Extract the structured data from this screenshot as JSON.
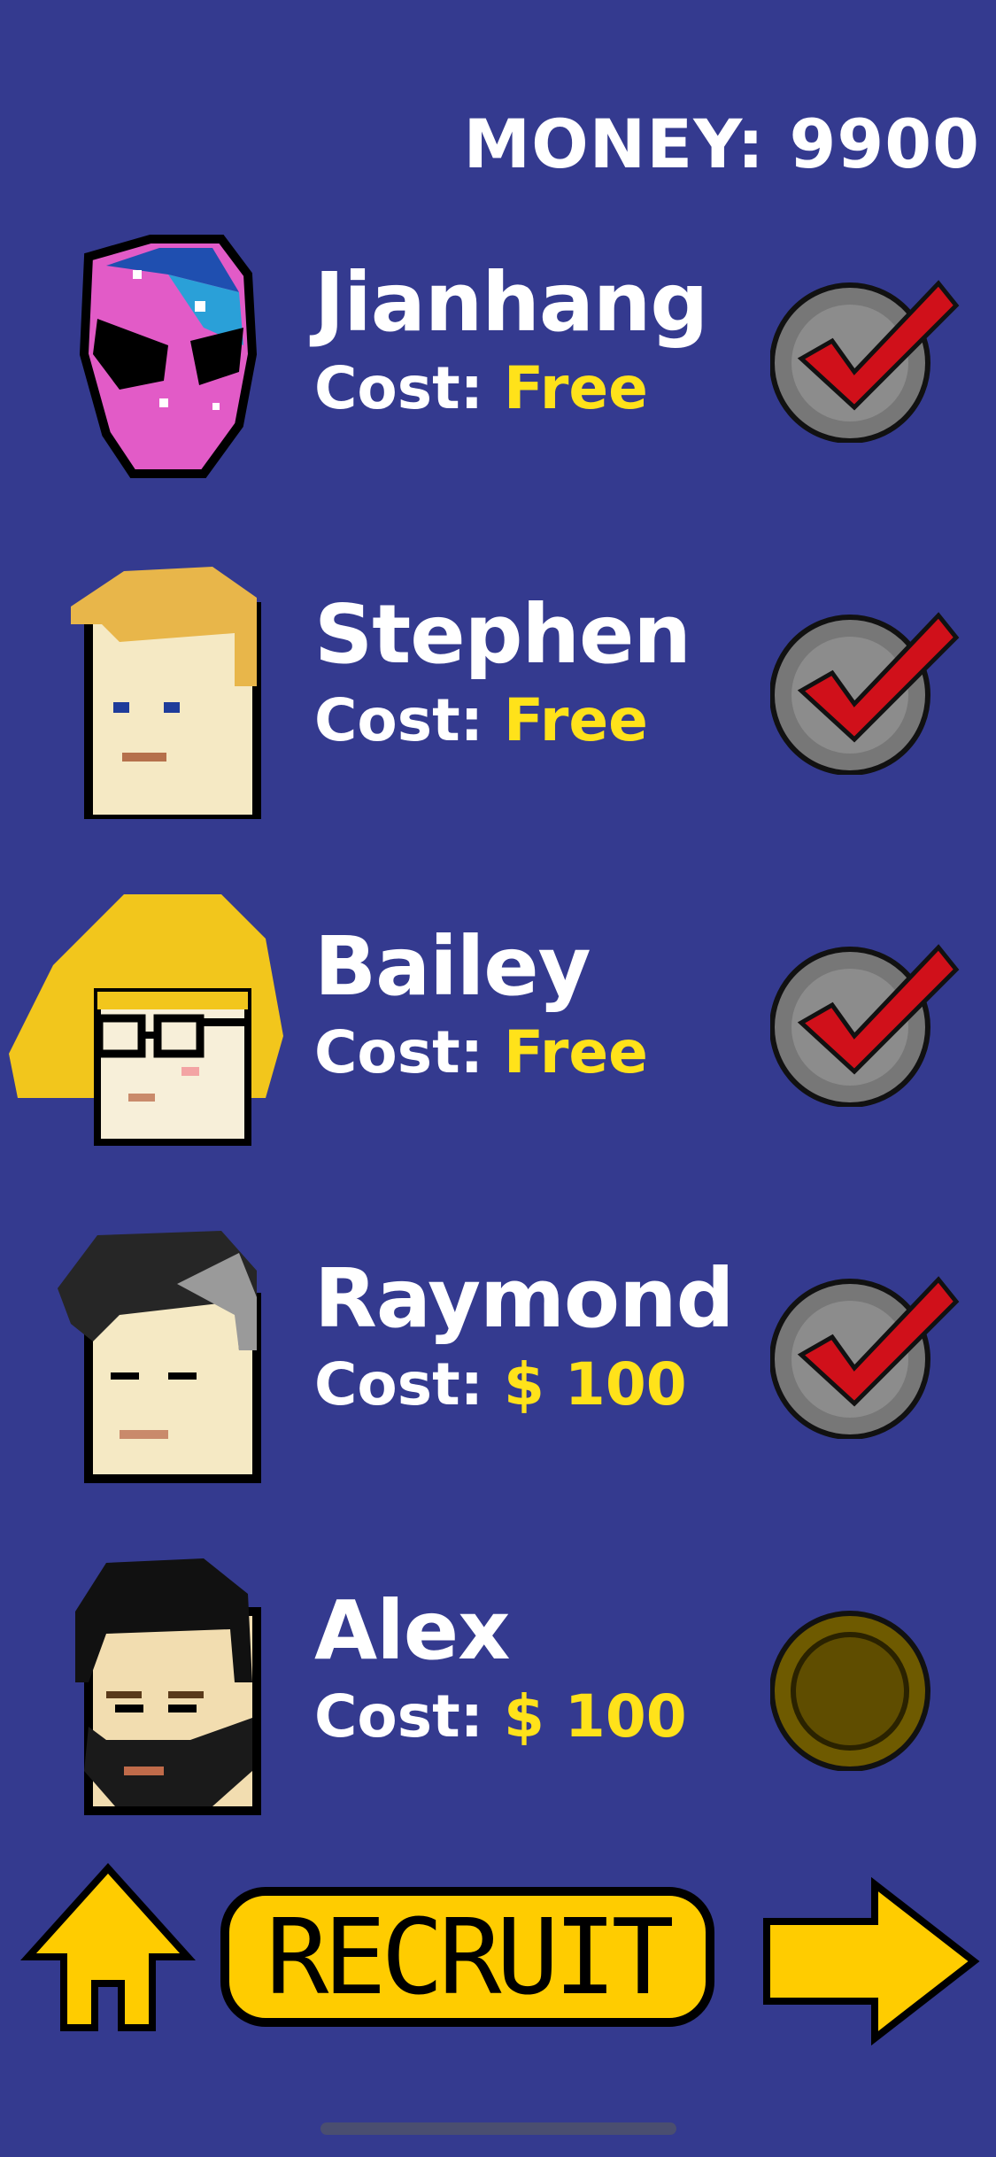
{
  "money": "MONEY: 9900",
  "characters": [
    {
      "name": "Jianhang",
      "cost_label": "Cost:",
      "cost_value": "Free",
      "recruited": true,
      "avatar_icon": "alien-mask-icon"
    },
    {
      "name": "Stephen",
      "cost_label": "Cost:",
      "cost_value": "Free",
      "recruited": true,
      "avatar_icon": "blond-man-icon"
    },
    {
      "name": "Bailey",
      "cost_label": "Cost:",
      "cost_value": "Free",
      "recruited": true,
      "avatar_icon": "glasses-woman-icon"
    },
    {
      "name": "Raymond",
      "cost_label": "Cost:",
      "cost_value": "$ 100",
      "recruited": true,
      "avatar_icon": "grey-streak-man-icon"
    },
    {
      "name": "Alex",
      "cost_label": "Cost:",
      "cost_value": "$ 100",
      "recruited": false,
      "avatar_icon": "bearded-man-icon"
    }
  ],
  "buttons": {
    "home_icon": "home-arrow-icon",
    "recruit_label": "RECRUIT",
    "next_icon": "right-arrow-icon"
  },
  "colors": {
    "background": "#343a8f",
    "accent": "#ffe21a",
    "check": "#d0101a"
  }
}
